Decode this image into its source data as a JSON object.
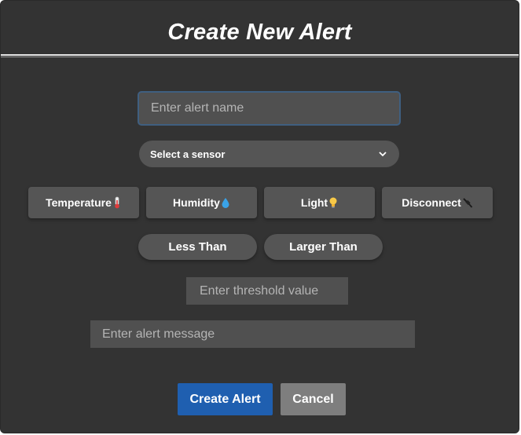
{
  "dialog": {
    "title": "Create New Alert"
  },
  "form": {
    "alert_name_placeholder": "Enter alert name",
    "sensor_select_label": "Select a sensor",
    "sensor_buttons": [
      {
        "label": "Temperature",
        "icon": "thermometer-icon"
      },
      {
        "label": "Humidity",
        "icon": "droplet-icon"
      },
      {
        "label": "Light",
        "icon": "lightbulb-icon"
      },
      {
        "label": "Disconnect",
        "icon": "unplug-icon"
      }
    ],
    "comparison_buttons": [
      {
        "label": "Less Than"
      },
      {
        "label": "Larger Than"
      }
    ],
    "threshold_placeholder": "Enter threshold value",
    "message_placeholder": "Enter alert message"
  },
  "actions": {
    "create_label": "Create Alert",
    "cancel_label": "Cancel"
  },
  "colors": {
    "background": "#333333",
    "control": "#555555",
    "primary": "#1f5fb0",
    "secondary": "#7e7e7e",
    "focus_border": "#3f5f80"
  }
}
